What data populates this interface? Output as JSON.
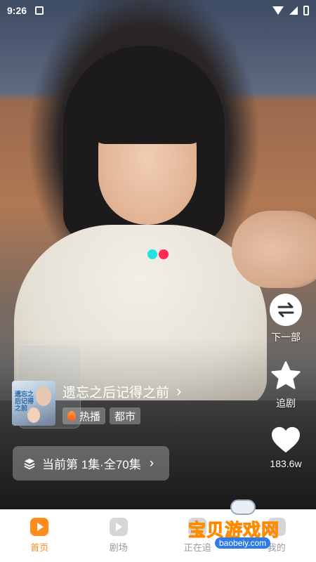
{
  "status_bar": {
    "time": "9:26"
  },
  "loader_colors": [
    "#22e0e6",
    "#ff2a55"
  ],
  "side_actions": {
    "next": {
      "label": "下一部",
      "icon": "swap-arrows-icon"
    },
    "follow": {
      "label": "追剧",
      "icon": "star-icon"
    },
    "like": {
      "label": "183.6w",
      "icon": "heart-icon"
    }
  },
  "drama": {
    "title": "遗忘之后记得之前",
    "poster_text": "遗忘之后记得之前",
    "tags": [
      "热播",
      "都市"
    ]
  },
  "episode": {
    "label": "当前第 1集·全70集"
  },
  "tabbar": {
    "items": [
      {
        "label": "首页",
        "active": true
      },
      {
        "label": "剧场",
        "active": false
      },
      {
        "label": "正在追",
        "active": false
      },
      {
        "label": "我的",
        "active": false
      }
    ]
  },
  "watermark": {
    "text": "宝贝游戏网",
    "url": "baobeiy.com"
  },
  "colors": {
    "accent": "#ff8a1e",
    "tab_inactive": "#9a9a9a"
  }
}
